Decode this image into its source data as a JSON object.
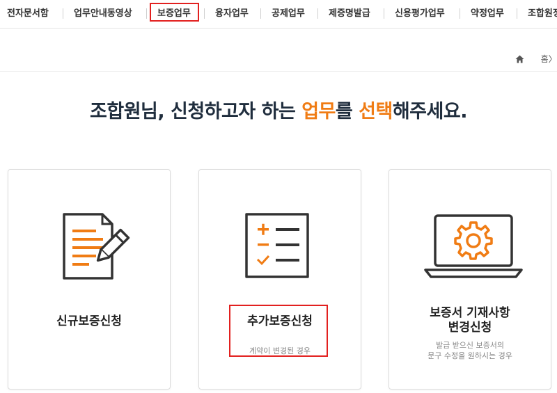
{
  "nav": {
    "items": [
      {
        "label": "전자문서함"
      },
      {
        "label": "업무안내동영상"
      },
      {
        "label": "보증업무",
        "active": true
      },
      {
        "label": "융자업무"
      },
      {
        "label": "공제업무"
      },
      {
        "label": "제증명발급"
      },
      {
        "label": "신용평가업무"
      },
      {
        "label": "약정업무"
      },
      {
        "label": "조합원정"
      }
    ],
    "highlight_color": "#e2201f"
  },
  "breadcrumb": {
    "home_icon": "home-icon",
    "home_label": "홈",
    "separator": "〉"
  },
  "headline": {
    "part1": "조합원님, 신청하고자 하는 ",
    "emph1": "업무",
    "part2": "를 ",
    "emph2": "선택",
    "part3": "해주세요.",
    "emph_color": "#f07c14"
  },
  "cards": [
    {
      "icon": "document-pencil-icon",
      "title": "신규보증신청",
      "subtitle": ""
    },
    {
      "icon": "checklist-icon",
      "title": "추가보증신청",
      "subtitle": "계약이 변경된 경우"
    },
    {
      "icon": "laptop-gear-icon",
      "title_line1": "보증서 기재사항",
      "title_line2": "변경신청",
      "subtitle_line1": "발급 받으신 보증서의",
      "subtitle_line2": "문구 수정을 원하시는 경우"
    }
  ],
  "colors": {
    "accent": "#f07c14",
    "icon_dark": "#333333",
    "headline": "#1f2d3d"
  }
}
